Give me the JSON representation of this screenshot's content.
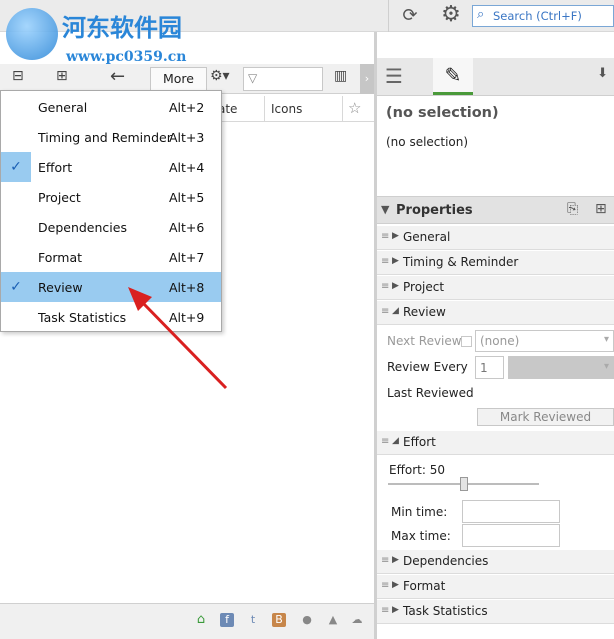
{
  "topbar": {
    "search_placeholder": "Search (Ctrl+F)",
    "sync_icon": "⟳",
    "settings_icon": "⚙"
  },
  "watermark": {
    "title": "河东软件园",
    "url": "www.pc0359.cn"
  },
  "toolbar": {
    "more_label": "More"
  },
  "columns": {
    "date_partial": "ate",
    "icons": "Icons"
  },
  "menu": {
    "items": [
      {
        "label": "General",
        "accel": "Alt+2",
        "checked": false,
        "highlighted": false
      },
      {
        "label": "Timing and Reminder",
        "accel": "Alt+3",
        "checked": false,
        "highlighted": false
      },
      {
        "label": "Effort",
        "accel": "Alt+4",
        "checked": true,
        "highlighted": false
      },
      {
        "label": "Project",
        "accel": "Alt+5",
        "checked": false,
        "highlighted": false
      },
      {
        "label": "Dependencies",
        "accel": "Alt+6",
        "checked": false,
        "highlighted": false
      },
      {
        "label": "Format",
        "accel": "Alt+7",
        "checked": false,
        "highlighted": false
      },
      {
        "label": "Review",
        "accel": "Alt+8",
        "checked": true,
        "highlighted": true
      },
      {
        "label": "Task Statistics",
        "accel": "Alt+9",
        "checked": false,
        "highlighted": false
      }
    ]
  },
  "detail": {
    "title": "(no selection)",
    "subtitle": "(no selection)"
  },
  "properties": {
    "header": "Properties",
    "sections": {
      "general": "General",
      "timing": "Timing & Reminder",
      "project": "Project",
      "review": "Review",
      "effort": "Effort",
      "dependencies": "Dependencies",
      "format": "Format",
      "task_statistics": "Task Statistics"
    },
    "review": {
      "next_review_label": "Next Review",
      "next_review_value": "(none)",
      "review_every_label": "Review Every",
      "review_every_value": "1",
      "last_reviewed_label": "Last Reviewed",
      "mark_reviewed_label": "Mark Reviewed"
    },
    "effort": {
      "label": "Effort: 50",
      "slider_value": 50,
      "min_time_label": "Min time:",
      "max_time_label": "Max time:"
    }
  },
  "colors": {
    "menu_highlight": "#99cbf0",
    "accent_tab": "#4a9a3a",
    "annotation_arrow": "#d92020"
  }
}
